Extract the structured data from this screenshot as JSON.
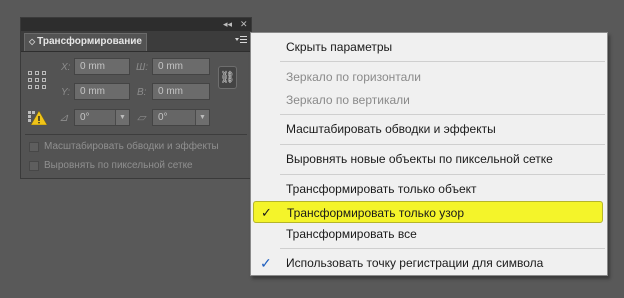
{
  "panel": {
    "tab_title": "Трансформирование",
    "titlebar_collapse": "◂◂",
    "titlebar_close": "✕",
    "menu_button_icon": "panel-menu-icon",
    "x_label": "X:",
    "x_value": "0 mm",
    "w_label": "Ш:",
    "w_value": "0 mm",
    "y_label": "Y:",
    "y_value": "0 mm",
    "h_label": "В:",
    "h_value": "0 mm",
    "rotate_value": "0°",
    "shear_value": "0°",
    "check_scale_strokes": "Масштабировать обводки и эффекты",
    "check_align_pixel": "Выровнять по пиксельной сетке"
  },
  "menu": {
    "items": [
      {
        "label": "Скрыть параметры",
        "enabled": true
      },
      {
        "label": "Зеркало по горизонтали",
        "enabled": false
      },
      {
        "label": "Зеркало по вертикали",
        "enabled": false
      },
      {
        "label": "Масштабировать обводки и эффекты",
        "enabled": true
      },
      {
        "label": "Выровнять новые объекты по пиксельной сетке",
        "enabled": true
      },
      {
        "label": "Трансформировать только объект",
        "enabled": true
      },
      {
        "label": "Трансформировать только узор",
        "enabled": true,
        "checked": true,
        "highlighted": true,
        "highlight_color": "#f4f42a"
      },
      {
        "label": "Трансформировать все",
        "enabled": true
      },
      {
        "label": "Использовать точку регистрации для символа",
        "enabled": true,
        "checked": true,
        "check_color": "#1f5fbf"
      }
    ],
    "check_glyph": "✓"
  }
}
